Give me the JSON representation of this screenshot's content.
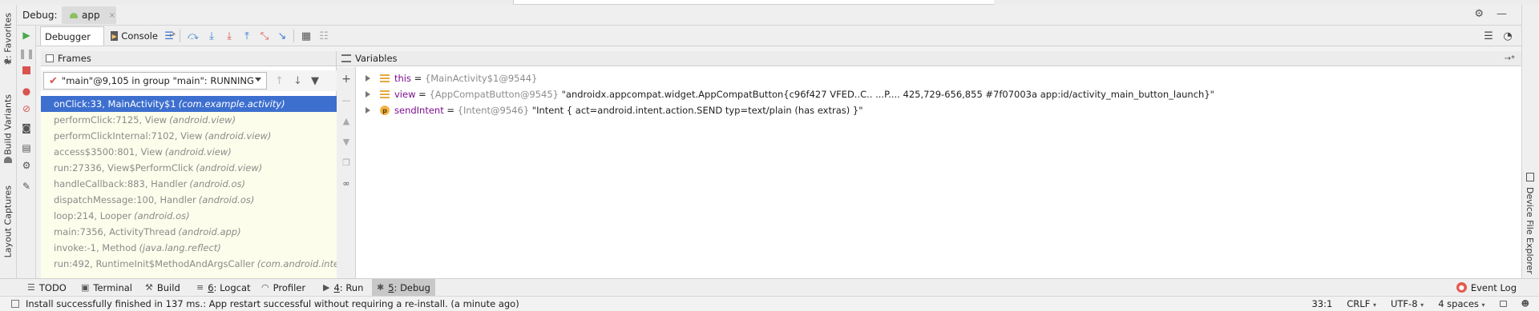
{
  "debug_header": {
    "title": "Debug:",
    "app_tab": "app",
    "close": "×",
    "gear": "⚙",
    "minimize": "—"
  },
  "tabs": {
    "debugger": "Debugger",
    "console": "Console",
    "console_pin": "→*"
  },
  "frames": {
    "title": "Frames",
    "thread": "\"main\"@9,105 in group \"main\": RUNNING",
    "items": [
      {
        "method": "onClick:33, MainActivity$1",
        "pkg": "(com.example.activity)"
      },
      {
        "method": "performClick:7125, View",
        "pkg": "(android.view)"
      },
      {
        "method": "performClickInternal:7102, View",
        "pkg": "(android.view)"
      },
      {
        "method": "access$3500:801, View",
        "pkg": "(android.view)"
      },
      {
        "method": "run:27336, View$PerformClick",
        "pkg": "(android.view)"
      },
      {
        "method": "handleCallback:883, Handler",
        "pkg": "(android.os)"
      },
      {
        "method": "dispatchMessage:100, Handler",
        "pkg": "(android.os)"
      },
      {
        "method": "loop:214, Looper",
        "pkg": "(android.os)"
      },
      {
        "method": "main:7356, ActivityThread",
        "pkg": "(android.app)"
      },
      {
        "method": "invoke:-1, Method",
        "pkg": "(java.lang.reflect)"
      },
      {
        "method": "run:492, RuntimeInit$MethodAndArgsCaller",
        "pkg": "(com.android.internal.os)"
      }
    ]
  },
  "variables": {
    "title": "Variables",
    "pin": "→*",
    "items": [
      {
        "name": "this",
        "eq": " = ",
        "type": "{MainActivity$1@9544}",
        "value": ""
      },
      {
        "name": "view",
        "eq": " = ",
        "type": "{AppCompatButton@9545}",
        "value": "\"androidx.appcompat.widget.AppCompatButton{c96f427 VFED..C.. ...P.... 425,729-656,855 #7f07003a app:id/activity_main_button_launch}\""
      },
      {
        "name": "sendIntent",
        "eq": " = ",
        "type": "{Intent@9546}",
        "value": "\"Intent { act=android.intent.action.SEND typ=text/plain (has extras) }\""
      }
    ]
  },
  "left_strip": {
    "favorites": "2: Favorites",
    "build_variants": "Build Variants",
    "layout_captures": "Layout Captures"
  },
  "right_strip": {
    "device_file_explorer": "Device File Explorer"
  },
  "bottom_bar": {
    "todo": "TODO",
    "terminal": "Terminal",
    "build": "Build",
    "logcat_num": "6",
    "logcat": ": Logcat",
    "profiler": "Profiler",
    "run_num": "4",
    "run": ": Run",
    "debug_num": "5",
    "debug": ": Debug",
    "event_log": "Event Log"
  },
  "status": {
    "message": "Install successfully finished in 137 ms.: App restart successful without requiring a re-install. (a minute ago)",
    "position": "33:1",
    "line_sep": "CRLF",
    "encoding": "UTF-8",
    "indent": "4 spaces"
  }
}
